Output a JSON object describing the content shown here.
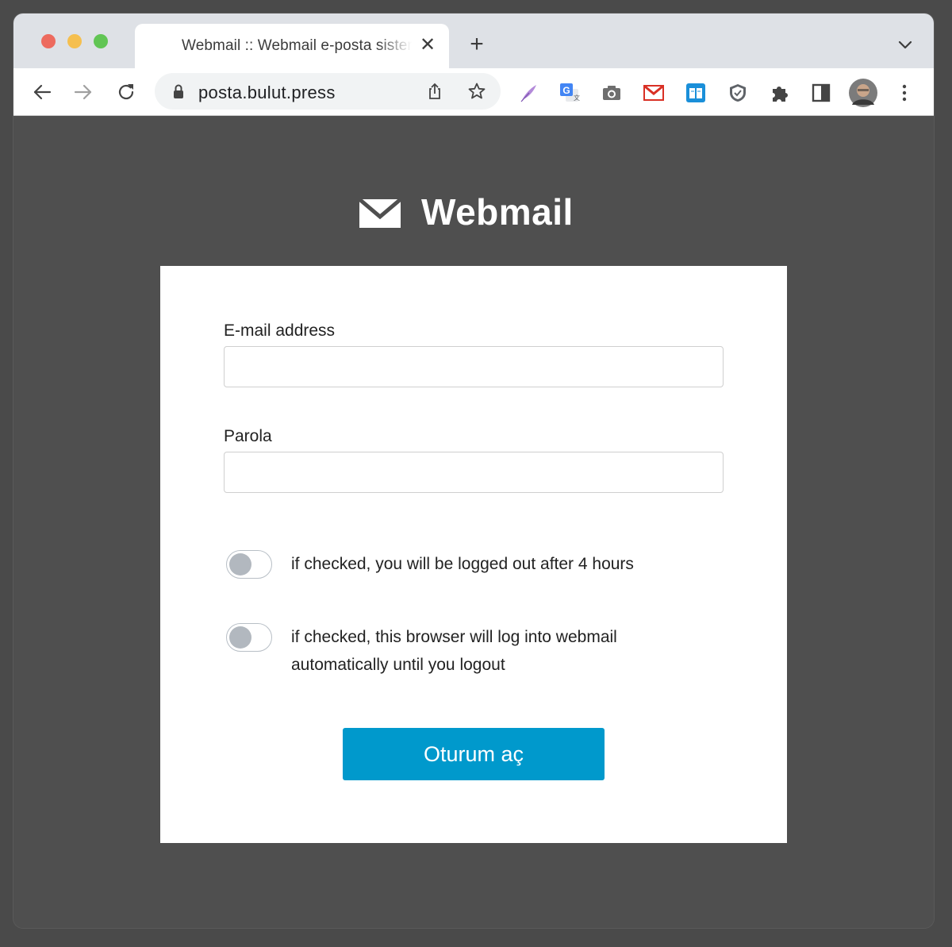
{
  "browser": {
    "tab_title": "Webmail :: Webmail e-posta sistemi",
    "tab_close": "✕",
    "new_tab": "+",
    "url": "posta.bulut.press"
  },
  "colors": {
    "accent": "#0099cc",
    "page_background": "#4f4f4f"
  },
  "icons": {
    "toolbar": [
      "back-icon",
      "forward-icon",
      "reload-icon",
      "lock-icon",
      "share-icon",
      "bookmark-star-icon"
    ],
    "extensions": [
      "quill-extension-icon",
      "google-translate-icon",
      "camera-icon",
      "gmail-icon",
      "reader-icon",
      "csp-shield-icon",
      "extensions-puzzle-icon",
      "side-panel-icon",
      "profile-avatar",
      "menu-dots-icon"
    ]
  },
  "header": {
    "brand_name": "Webmail"
  },
  "form": {
    "email_label": "E-mail address",
    "email_value": "",
    "password_label": "Parola",
    "password_value": "",
    "toggle_logout_text": "if checked, you will be logged out after 4 hours",
    "toggle_logout_checked": false,
    "toggle_autologin_text": "if checked, this browser will log into webmail automatically until you logout",
    "toggle_autologin_checked": false,
    "submit_label": "Oturum aç"
  }
}
